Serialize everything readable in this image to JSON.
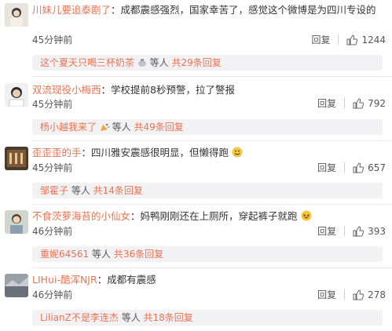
{
  "comments": [
    {
      "user": "川妹儿要追泰剧了",
      "text": "：成都震感强烈，国家幸苦了，感觉这个微博是为四川专设的",
      "time": "45分钟前",
      "reply_label": "回复",
      "likes": "1244",
      "reply_user": "这个夏天只喝三杯奶茶",
      "reply_emoji": "pot-emoji",
      "reply_mid": " 等人 ",
      "reply_count": "共29条回复"
    },
    {
      "user": "双流现役小梅西",
      "text": "：学校提前8秒预警，拉了警报",
      "time": "45分钟前",
      "reply_label": "回复",
      "likes": "792",
      "reply_user": "杨小越我来了",
      "reply_emoji": "party-emoji",
      "reply_mid": " 等人 ",
      "reply_count": "共49条回复"
    },
    {
      "user": "歪歪歪的手",
      "text": "：四川雅安震感很明显，但懒得跑",
      "time": "45分钟前",
      "reply_label": "回复",
      "likes": "657",
      "reply_user": "邹霍子",
      "reply_mid": " 等人 ",
      "reply_count": "共14条回复"
    },
    {
      "user": "不食茨萝海苔的小仙女",
      "text": "：妈鸭刚刚还在上厕所，穿起裤子就跑",
      "time": "46分钟前",
      "reply_label": "回复",
      "likes": "393",
      "reply_user": "重妮64561",
      "reply_mid": " 等人 ",
      "reply_count": "共36条回复"
    },
    {
      "user": "LIHui-酷浑NJR",
      "text": "：成都有震感",
      "time": "46分钟前",
      "reply_label": "回复",
      "likes": "278",
      "reply_user": "LilianZ不是李连杰",
      "reply_mid": " 等人 ",
      "reply_count": "共18条回复"
    }
  ],
  "colors": {
    "accent": "#eb7350",
    "reply_bg": "#f2f2f5"
  }
}
